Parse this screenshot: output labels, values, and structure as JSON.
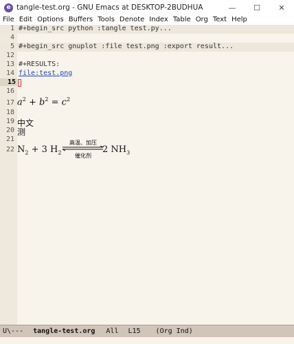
{
  "window": {
    "icon_letter": "e",
    "title": "tangle-test.org - GNU Emacs at DESKTOP-2BUDHUA",
    "controls": [
      "—",
      "☐",
      "✕"
    ]
  },
  "menubar": [
    "File",
    "Edit",
    "Options",
    "Buffers",
    "Tools",
    "Denote",
    "Index",
    "Table",
    "Org",
    "Text",
    "Help"
  ],
  "editor": {
    "lines": [
      {
        "num": "1",
        "text": "#+begin_src python :tangle test.py..."
      },
      {
        "num": "4",
        "text": ""
      },
      {
        "num": "5",
        "text": "#+begin_src gnuplot :file test.png :export result..."
      },
      {
        "num": "12",
        "text": ""
      },
      {
        "num": "13",
        "text": "#+RESULTS:"
      },
      {
        "num": "14",
        "text": "file:test.png"
      },
      {
        "num": "15",
        "text": ""
      },
      {
        "num": "16",
        "text": ""
      },
      {
        "num": "17",
        "text": ""
      },
      {
        "num": "18",
        "text": ""
      },
      {
        "num": "19",
        "text": "中文"
      },
      {
        "num": "20",
        "text": "测"
      },
      {
        "num": "21",
        "text": ""
      },
      {
        "num": "22",
        "text": ""
      }
    ],
    "equation_17": {
      "a": "a",
      "two": "2",
      "plus": "+",
      "b": "b",
      "eq": "=",
      "c": "c"
    },
    "equation_22": {
      "n2": "N",
      "sub2": "2",
      "plus": "+ 3",
      "h2": "H",
      "sub_h": "2",
      "above": "高温、加压",
      "below": "催化剂",
      "product": "2 NH",
      "sub3": "3"
    }
  },
  "modeline": {
    "status": "U\\---",
    "buffer": "tangle-test.org",
    "position": "All",
    "line": "L15",
    "mode": "(Org Ind)"
  }
}
